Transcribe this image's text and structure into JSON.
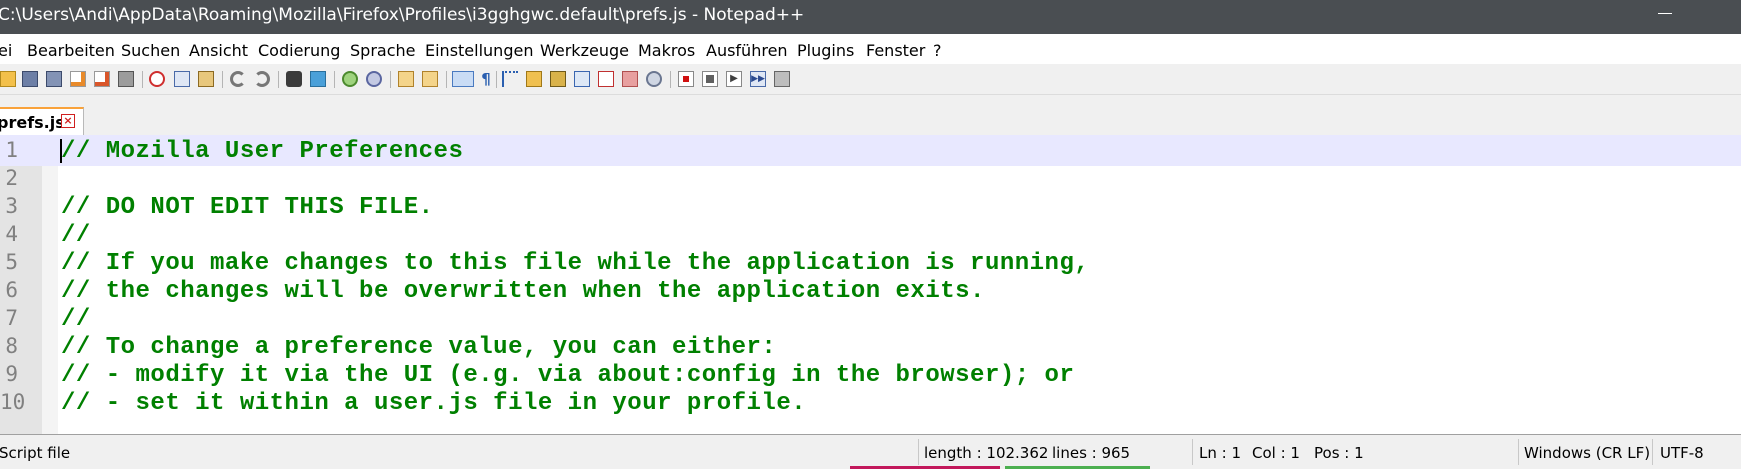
{
  "window": {
    "title": "C:\\Users\\Andi\\AppData\\Roaming\\Mozilla\\Firefox\\Profiles\\i3gghgwc.default\\prefs.js - Notepad++"
  },
  "menu": [
    {
      "id": "datei",
      "label": "ei"
    },
    {
      "id": "bearbeiten",
      "label": "Bearbeiten"
    },
    {
      "id": "suchen",
      "label": "Suchen"
    },
    {
      "id": "ansicht",
      "label": "Ansicht"
    },
    {
      "id": "codierung",
      "label": "Codierung"
    },
    {
      "id": "sprache",
      "label": "Sprache"
    },
    {
      "id": "einstellungen",
      "label": "Einstellungen"
    },
    {
      "id": "werkzeuge",
      "label": "Werkzeuge"
    },
    {
      "id": "makros",
      "label": "Makros"
    },
    {
      "id": "ausfuehren",
      "label": "Ausführen"
    },
    {
      "id": "plugins",
      "label": "Plugins"
    },
    {
      "id": "fenster",
      "label": "Fenster"
    },
    {
      "id": "hilfe",
      "label": "?"
    }
  ],
  "toolbar": {
    "icons": [
      "open-icon",
      "save-icon",
      "save-all-icon",
      "close-icon",
      "close-all-icon",
      "print-icon",
      "cut-icon",
      "copy-icon",
      "paste-icon",
      "undo-icon",
      "redo-icon",
      "find-icon",
      "replace-icon",
      "zoom-in-icon",
      "zoom-out-icon",
      "sync-vertical-icon",
      "sync-horizontal-icon",
      "word-wrap-icon",
      "show-all-chars-icon",
      "indent-guide-icon",
      "udl-icon",
      "doc-map-icon",
      "function-list-icon",
      "folder-workspace-icon",
      "monitoring-icon",
      "macro-record-icon",
      "macro-stop-icon",
      "macro-play-icon",
      "macro-run-multiple-icon",
      "macro-save-icon"
    ]
  },
  "tab": {
    "label": "prefs.js",
    "close_glyph": "×"
  },
  "editor": {
    "lines": [
      {
        "n": "1",
        "text": "// Mozilla User Preferences"
      },
      {
        "n": "2",
        "text": ""
      },
      {
        "n": "3",
        "text": "// DO NOT EDIT THIS FILE."
      },
      {
        "n": "4",
        "text": "//"
      },
      {
        "n": "5",
        "text": "// If you make changes to this file while the application is running,"
      },
      {
        "n": "6",
        "text": "// the changes will be overwritten when the application exits."
      },
      {
        "n": "7",
        "text": "//"
      },
      {
        "n": "8",
        "text": "// To change a preference value, you can either:"
      },
      {
        "n": "9",
        "text": "// - modify it via the UI (e.g. via about:config in the browser); or"
      },
      {
        "n": "10",
        "text": "// - set it within a user.js file in your profile."
      }
    ]
  },
  "status": {
    "filetype": "Script file",
    "length": "length : 102.362",
    "lines": "lines : 965",
    "ln": "Ln : 1",
    "col": "Col : 1",
    "pos": "Pos : 1",
    "eol": "Windows (CR LF)",
    "encoding": "UTF-8"
  },
  "colors": {
    "comment": "#008000",
    "title_bar": "#4a4e52",
    "current_line": "#e8e8ff",
    "tab_accent": "#f9a23a"
  }
}
